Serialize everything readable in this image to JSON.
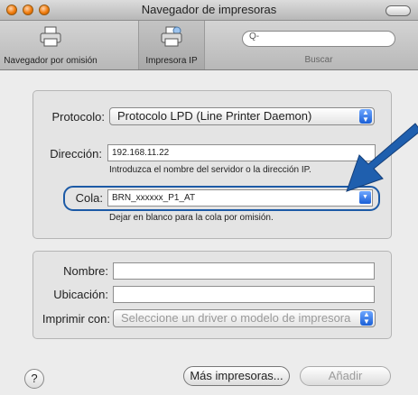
{
  "window": {
    "title": "Navegador de impresoras"
  },
  "toolbar": {
    "default_browser": "Navegador por omisión",
    "ip_printer": "Impresora IP",
    "search_placeholder": "Q-",
    "search_label": "Buscar"
  },
  "ip_form": {
    "protocol_label": "Protocolo:",
    "protocol_value": "Protocolo LPD (Line Printer Daemon)",
    "address_label": "Dirección:",
    "address_value": "192.168.11.22",
    "address_hint": "Introduzca el nombre del servidor o la dirección IP.",
    "queue_label": "Cola:",
    "queue_value": "BRN_xxxxxx_P1_AT",
    "queue_hint": "Dejar en blanco para la cola por omisión."
  },
  "printer_info": {
    "name_label": "Nombre:",
    "name_value": "",
    "location_label": "Ubicación:",
    "location_value": "",
    "print_with_label": "Imprimir con:",
    "print_with_value": "Seleccione un driver o modelo de impresora"
  },
  "footer": {
    "help": "?",
    "more_printers": "Más impresoras...",
    "add": "Añadir"
  },
  "annotation": {
    "arrow_color": "#1f5fae",
    "highlight_color": "#1c5aa6"
  }
}
